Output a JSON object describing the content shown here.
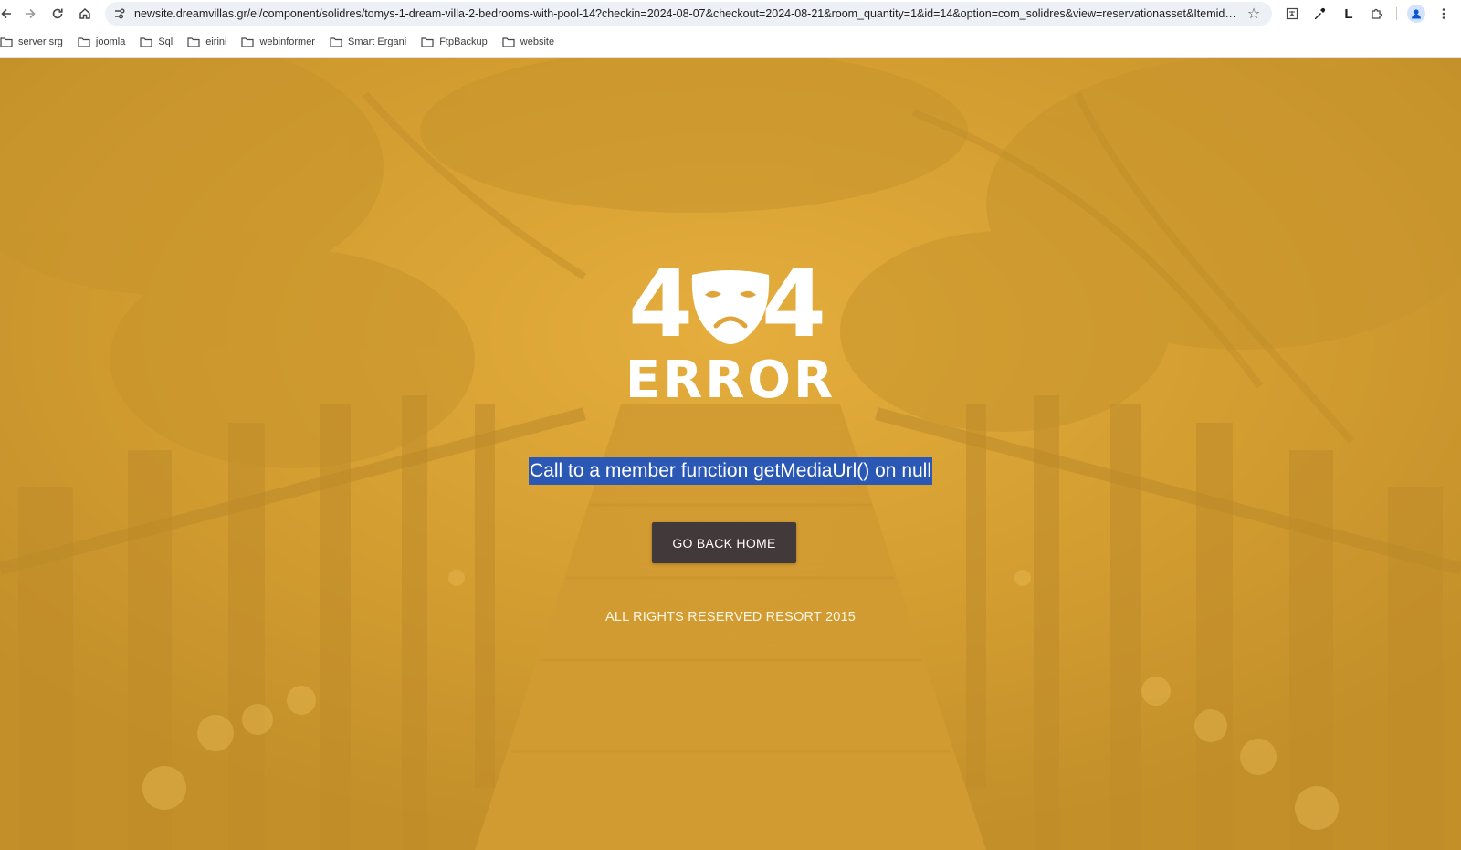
{
  "browser": {
    "url": "newsite.dreamvillas.gr/el/component/solidres/tomys-1-dream-villa-2-bedrooms-with-pool-14?checkin=2024-08-07&checkout=2024-08-21&room_quantity=1&id=14&option=com_solidres&view=reservationasset&Itemid=854&b...",
    "extension_letter": "L",
    "bookmarks": [
      "server srg",
      "joomla",
      "Sql",
      "eirini",
      "webinformer",
      "Smart Ergani",
      "FtpBackup",
      "website"
    ]
  },
  "error_page": {
    "digit_left": "4",
    "digit_right": "4",
    "error_word": "ERROR",
    "message": "Call to a member function getMediaUrl() on null",
    "home_button_label": "GO BACK HOME",
    "footer": "ALL RIGHTS RESERVED RESORT 2015"
  },
  "colors": {
    "overlay": "#e2aa34",
    "selection": "#2b58b5",
    "button": "#423a3a"
  }
}
